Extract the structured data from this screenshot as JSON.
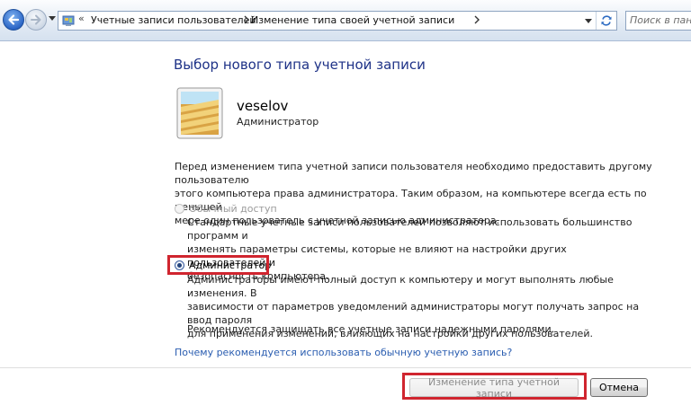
{
  "nav": {
    "breadcrumb": [
      "Учетные записи пользователей",
      "Изменение типа своей учетной записи"
    ],
    "search_placeholder": "Поиск в пане"
  },
  "content": {
    "title": "Выбор нового типа учетной записи",
    "user": {
      "name": "veselov",
      "role": "Администратор"
    },
    "intro_lines": [
      "Перед изменением типа учетной записи пользователя необходимо предоставить другому пользователю",
      "этого компьютера права администратора. Таким образом, на компьютере всегда есть по меньшей",
      "мере один пользователь с учетной записью администратора."
    ],
    "options": [
      {
        "label": "Обычный доступ",
        "selected": false,
        "enabled": false,
        "desc_lines": [
          "Стандартные учетные записи пользователей позволяют использовать большинство программ и",
          "изменять параметры системы, которые не влияют на настройки других пользователей и",
          "безопасность компьютера."
        ]
      },
      {
        "label": "Администратор",
        "selected": true,
        "enabled": true,
        "desc_lines": [
          "Администраторы имеют полный доступ к компьютеру и могут выполнять любые изменения. В",
          "зависимости от параметров уведомлений администраторы могут получать запрос на ввод пароля",
          "для применения изменений, влияющих на настройки других пользователей."
        ]
      }
    ],
    "recommendation": "Рекомендуется защищать все учетные записи надежными паролями.",
    "help_link": "Почему рекомендуется использовать обычную учетную запись?"
  },
  "buttons": {
    "change_type": "Изменение типа учетной записи",
    "cancel": "Отмена"
  },
  "colors": {
    "title": "#1e3287",
    "link": "#2a5db0",
    "highlight": "#d0252f"
  },
  "icons": [
    "back-arrow-icon",
    "forward-arrow-icon",
    "control-panel-icon",
    "refresh-icon",
    "user-picture-icon"
  ]
}
